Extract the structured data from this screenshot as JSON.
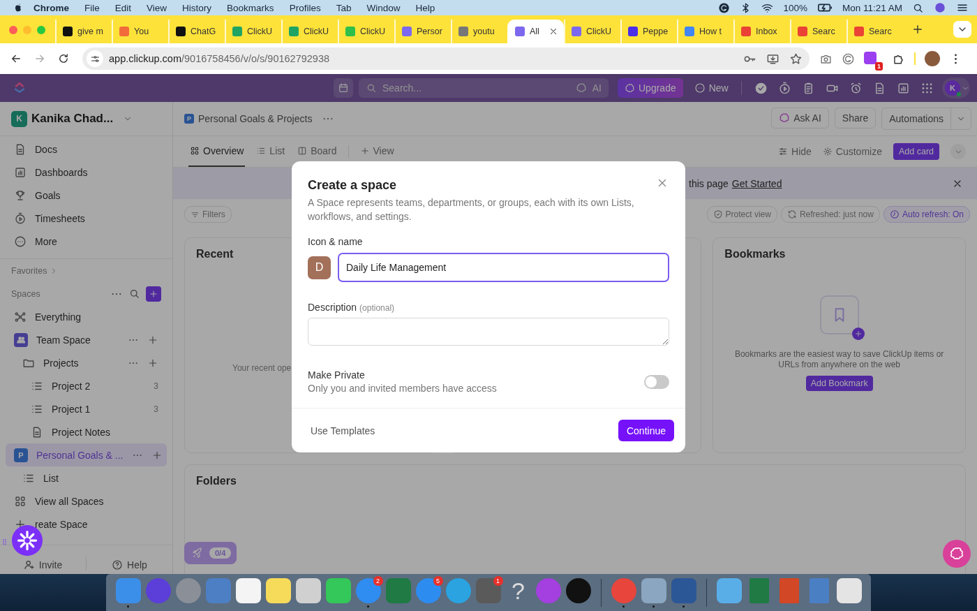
{
  "menubar": {
    "app": "Chrome",
    "menus": [
      "File",
      "Edit",
      "View",
      "History",
      "Bookmarks",
      "Profiles",
      "Tab",
      "Window",
      "Help"
    ],
    "battery": "100%",
    "clock": "Mon 11:21 AM"
  },
  "browser_tabs": [
    {
      "title": "give m",
      "color": "#111111",
      "selected": false
    },
    {
      "title": "You",
      "color": "#f26b3a",
      "selected": false
    },
    {
      "title": "ChatG",
      "color": "#111111",
      "selected": false
    },
    {
      "title": "ClickU",
      "color": "#1fa463",
      "selected": false
    },
    {
      "title": "ClickU",
      "color": "#1fa463",
      "selected": false
    },
    {
      "title": "ClickU",
      "color": "#2fbf4a",
      "selected": false
    },
    {
      "title": "Persor",
      "color": "#7b68ee",
      "selected": false
    },
    {
      "title": "youtu",
      "color": "#777777",
      "selected": false
    },
    {
      "title": "All",
      "color": "#7b68ee",
      "selected": true
    },
    {
      "title": "ClickU",
      "color": "#7b68ee",
      "selected": false
    },
    {
      "title": "Peppe",
      "color": "#4b2ee8",
      "selected": false
    },
    {
      "title": "How t",
      "color": "#4285f4",
      "selected": false
    },
    {
      "title": "Inbox",
      "color": "#ea4335",
      "selected": false
    },
    {
      "title": "Searc",
      "color": "#ea4335",
      "selected": false
    },
    {
      "title": "Searc",
      "color": "#ea4335",
      "selected": false
    }
  ],
  "address_bar": {
    "host": "app.clickup.com",
    "path": "/9016758456/v/o/s/90162792938"
  },
  "extension_badge": "1",
  "topbar": {
    "search_placeholder": "Search...",
    "ai": "AI",
    "upgrade": "Upgrade",
    "new": "New",
    "avatar": "K"
  },
  "sidebar": {
    "workspace": {
      "initial": "K",
      "name": "Kanika Chad..."
    },
    "nav": [
      {
        "label": "Docs",
        "kind": "doc"
      },
      {
        "label": "Dashboards",
        "kind": "chart"
      },
      {
        "label": "Goals",
        "kind": "trophy"
      },
      {
        "label": "Timesheets",
        "kind": "timer"
      },
      {
        "label": "More",
        "kind": "more"
      }
    ],
    "favorites": "Favorites",
    "spaces_label": "Spaces",
    "tree": [
      {
        "label": "Everything",
        "kind": "hub",
        "selected": false,
        "actions": false
      },
      {
        "label": "Team Space",
        "kind": "team",
        "selected": false,
        "actions": true,
        "children": [
          {
            "label": "Projects",
            "kind": "folder",
            "selected": false,
            "actions": true,
            "children": [
              {
                "label": "Project 2",
                "kind": "list",
                "count": "3",
                "selected": false,
                "actions": false
              },
              {
                "label": "Project 1",
                "kind": "list",
                "count": "3",
                "selected": false,
                "actions": false
              },
              {
                "label": "Project Notes",
                "kind": "doc",
                "selected": false,
                "actions": false
              }
            ]
          }
        ]
      },
      {
        "label": "Personal Goals & ...",
        "kind": "space",
        "initial": "P",
        "selected": true,
        "actions": true,
        "children": [
          {
            "label": "List",
            "kind": "list",
            "selected": false,
            "actions": false
          }
        ]
      },
      {
        "label": "View all Spaces",
        "kind": "grid",
        "selected": false,
        "actions": false
      },
      {
        "label": "reate Space",
        "kind": "add",
        "selected": false,
        "actions": false
      }
    ],
    "footer": {
      "invite": "Invite",
      "help": "Help"
    }
  },
  "header": {
    "badge": "P",
    "title": "Personal Goals & Projects",
    "ask_ai": "Ask AI",
    "share": "Share",
    "automations": "Automations"
  },
  "view_tabs": [
    {
      "label": "Overview",
      "kind": "overview",
      "selected": true
    },
    {
      "label": "List",
      "kind": "list",
      "selected": false
    },
    {
      "label": "Board",
      "kind": "board",
      "selected": false
    },
    {
      "label": "View",
      "kind": "add",
      "selected": false
    }
  ],
  "view_tools": {
    "hide": "Hide",
    "customize": "Customize",
    "add_card": "Add card"
  },
  "banner": {
    "text": "this page",
    "link": "Get Started"
  },
  "filters": {
    "label": "Filters",
    "chips": [
      {
        "label": "Protect view",
        "kind": "shield",
        "active": false
      },
      {
        "label": "Refreshed: just now",
        "kind": "refresh",
        "active": false
      },
      {
        "label": "Auto refresh: On",
        "kind": "clock",
        "active": true
      }
    ]
  },
  "cards": {
    "recent": {
      "title": "Recent",
      "empty_text": "Your recent ope"
    },
    "bookmarks": {
      "title": "Bookmarks",
      "text": "Bookmarks are the easiest way to save ClickUp items or URLs from anywhere on the web",
      "button": "Add Bookmark"
    },
    "folders": {
      "title": "Folders"
    }
  },
  "onboarding": {
    "progress": "0/4"
  },
  "modal": {
    "title": "Create a space",
    "description": "A Space represents teams, departments, or groups, each with its own Lists, workflows, and settings.",
    "icon_name_label": "Icon & name",
    "avatar": "D",
    "name_value": "Daily Life Management",
    "description_label": "Description",
    "description_hint": "(optional)",
    "private": {
      "label": "Make Private",
      "hint": "Only you and invited members have access",
      "on": false
    },
    "templates": "Use Templates",
    "continue": "Continue"
  },
  "dock": [
    {
      "kind": "tile",
      "color": "#3b8fe8",
      "running": true
    },
    {
      "kind": "circle",
      "color": "#5b3fd8",
      "running": false
    },
    {
      "kind": "circle",
      "color": "#8a8f98",
      "running": false
    },
    {
      "kind": "tile",
      "color": "#4d7fc4",
      "running": false
    },
    {
      "kind": "tile",
      "color": "#f4f4f4",
      "running": false
    },
    {
      "kind": "tile",
      "color": "#f6da5a",
      "running": false
    },
    {
      "kind": "tile",
      "color": "#d0d0d0",
      "running": false
    },
    {
      "kind": "tile",
      "color": "#34c759",
      "running": false
    },
    {
      "kind": "circle",
      "color": "#2f8cf0",
      "badge": "2",
      "running": true
    },
    {
      "kind": "tile",
      "color": "#1f7a44",
      "running": false
    },
    {
      "kind": "circle",
      "color": "#2d8cf0",
      "badge": "5",
      "running": false
    },
    {
      "kind": "circle",
      "color": "#2aa3e0",
      "running": false
    },
    {
      "kind": "tile",
      "color": "#5a5a5a",
      "badge": "1",
      "running": false
    },
    {
      "kind": "glyph",
      "glyph": "?",
      "running": false
    },
    {
      "kind": "circle",
      "color": "#a43fe0",
      "running": false
    },
    {
      "kind": "circle",
      "color": "#111111",
      "running": false
    },
    {
      "kind": "separator"
    },
    {
      "kind": "circle",
      "color": "#e8453c",
      "running": true
    },
    {
      "kind": "tile",
      "color": "#8aa6c0",
      "running": true
    },
    {
      "kind": "tile",
      "color": "#2b5797",
      "running": true
    },
    {
      "kind": "separator"
    },
    {
      "kind": "tile",
      "color": "#5aaee8",
      "running": false
    },
    {
      "kind": "doc",
      "color": "#1f7a44",
      "running": false
    },
    {
      "kind": "doc",
      "color": "#d24726",
      "running": false
    },
    {
      "kind": "doc",
      "color": "#4a7fc4",
      "running": false
    },
    {
      "kind": "tile",
      "color": "#e4e4e4",
      "running": false
    }
  ]
}
